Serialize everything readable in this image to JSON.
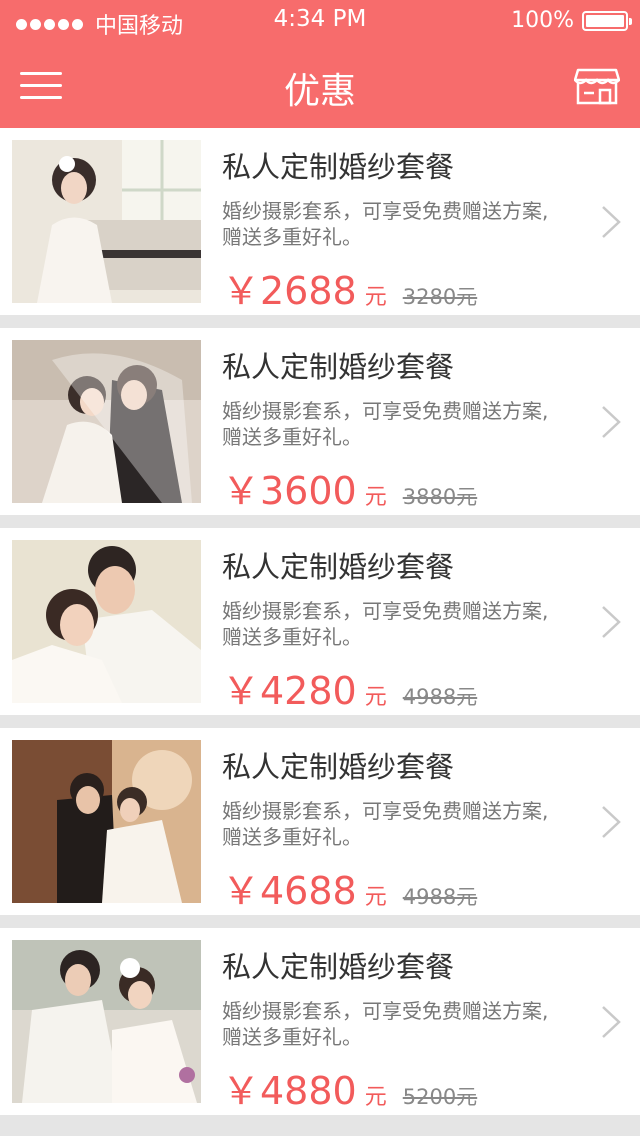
{
  "status_bar": {
    "carrier": "中国移动",
    "time": "4:34 PM",
    "battery": "100%"
  },
  "nav": {
    "title": "优惠",
    "menu_icon": "hamburger-menu-icon",
    "right_icon": "store-icon"
  },
  "colors": {
    "header": "#f76c6c",
    "price": "#f25b5b"
  },
  "packages": [
    {
      "title": "私人定制婚纱套餐",
      "description": "婚纱摄影套系，可享受免费赠送方案,赠送多重好礼。",
      "price": "￥2688",
      "unit": "元",
      "original_price": "3280元"
    },
    {
      "title": "私人定制婚纱套餐",
      "description": "婚纱摄影套系，可享受免费赠送方案,赠送多重好礼。",
      "price": "￥3600",
      "unit": "元",
      "original_price": "3880元"
    },
    {
      "title": "私人定制婚纱套餐",
      "description": "婚纱摄影套系，可享受免费赠送方案,赠送多重好礼。",
      "price": "￥4280",
      "unit": "元",
      "original_price": "4988元"
    },
    {
      "title": "私人定制婚纱套餐",
      "description": "婚纱摄影套系，可享受免费赠送方案,赠送多重好礼。",
      "price": "￥4688",
      "unit": "元",
      "original_price": "4988元"
    },
    {
      "title": "私人定制婚纱套餐",
      "description": "婚纱摄影套系，可享受免费赠送方案,赠送多重好礼。",
      "price": "￥4880",
      "unit": "元",
      "original_price": "5200元"
    }
  ]
}
